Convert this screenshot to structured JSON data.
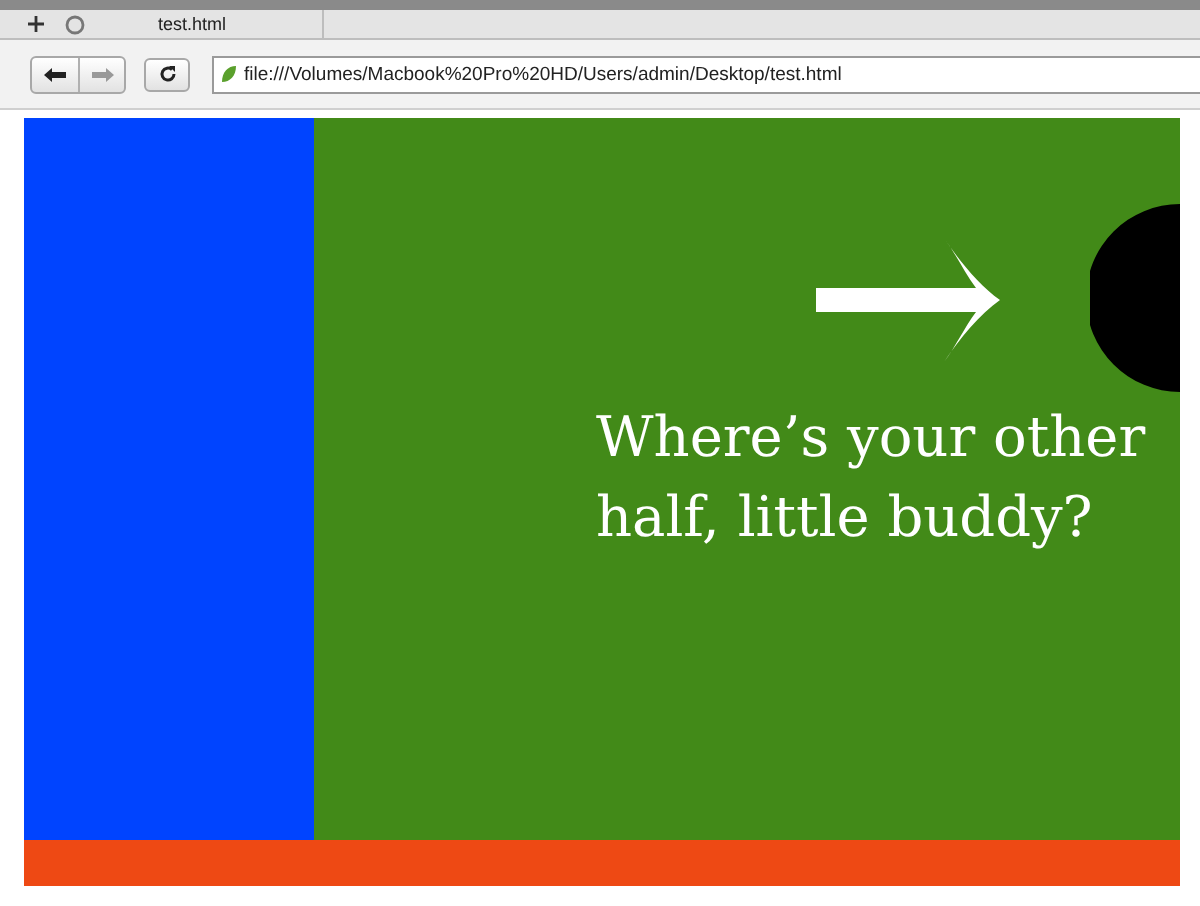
{
  "tab": {
    "title": "test.html"
  },
  "address_bar": {
    "url": "file:///Volumes/Macbook%20Pro%20HD/Users/admin/Desktop/test.html"
  },
  "page": {
    "message": "Where’s your other half, little buddy?"
  }
}
